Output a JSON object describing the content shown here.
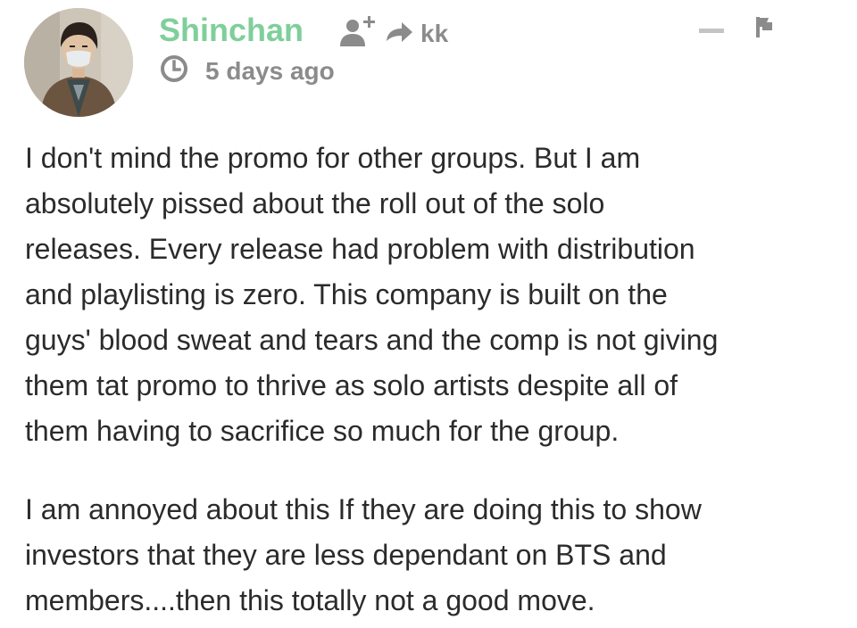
{
  "comment": {
    "author": "Shinchan",
    "reply_to": "kk",
    "timestamp": "5 days ago",
    "paragraphs": [
      [
        "I don't mind the promo for other groups. But I am",
        "absolutely pissed about the roll out of the solo",
        "releases. Every release had problem with distribution",
        "and playlisting is zero. This company is built on the",
        "guys' blood sweat and tears and the comp is not giving",
        "them tat promo to thrive as solo artists despite all of",
        "them having to sacrifice so much for the group."
      ],
      [
        "I am annoyed about this If they are doing this to show",
        "investors that they are less dependant on BTS and",
        "members....then this totally not a good move."
      ]
    ]
  },
  "icons": {
    "follow": "add-user-icon",
    "reply": "reply-arrow-icon",
    "time": "clock-icon",
    "minimize": "minimize-icon",
    "report": "flag-icon"
  },
  "colors": {
    "username": "#7fcf9a",
    "meta": "#8b8b8b",
    "body_text": "#2b2b2b",
    "background": "#ffffff"
  }
}
